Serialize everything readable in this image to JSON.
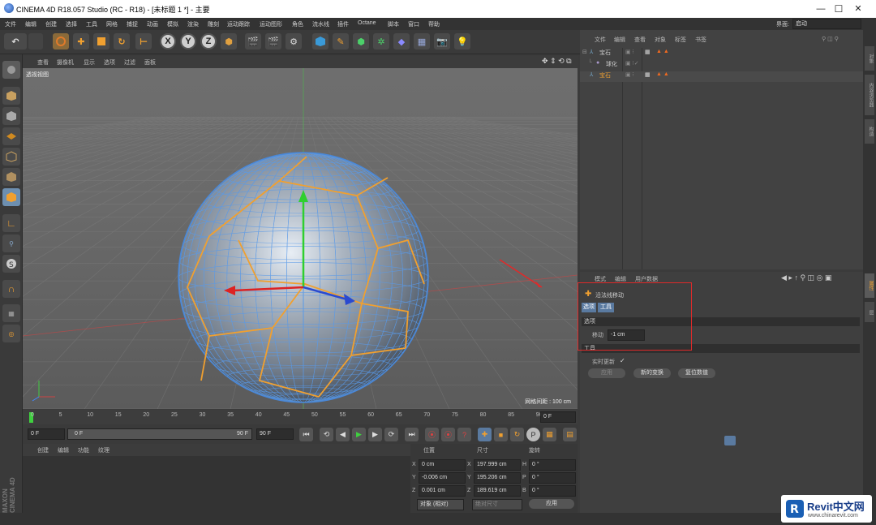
{
  "window": {
    "title": "CINEMA 4D R18.057 Studio (RC - R18) - [未标题 1 *] - 主要",
    "min": "—",
    "max": "☐",
    "close": "✕"
  },
  "menubar": {
    "items": [
      "文件",
      "编辑",
      "创建",
      "选择",
      "工具",
      "网格",
      "捕捉",
      "动画",
      "模拟",
      "渲染",
      "雕刻",
      "运动跟踪",
      "运动图形",
      "角色",
      "流水线",
      "插件",
      "Octane",
      "脚本",
      "窗口",
      "帮助"
    ],
    "layout_label": "界面:",
    "layout_value": "启动"
  },
  "toolbar": {
    "x": "X",
    "y": "Y",
    "z": "Z"
  },
  "viewport": {
    "menu": [
      "查看",
      "摄像机",
      "显示",
      "选项",
      "过滤",
      "面板"
    ],
    "label": "透视视图",
    "grid_spacing": "网格间距 : 100 cm"
  },
  "timeline": {
    "ticks": [
      "0",
      "5",
      "10",
      "15",
      "20",
      "25",
      "30",
      "35",
      "40",
      "45",
      "50",
      "55",
      "60",
      "65",
      "70",
      "75",
      "80",
      "85",
      "90"
    ],
    "end_field": "0 F"
  },
  "transport": {
    "current": "0 F",
    "start": "0 F",
    "end_a": "90 F",
    "end_b": "90 F"
  },
  "material": {
    "menu": [
      "创建",
      "编辑",
      "功能",
      "纹理"
    ]
  },
  "coords": {
    "headers": [
      "位置",
      "尺寸",
      "旋转"
    ],
    "rows": [
      {
        "axis": "X",
        "pos": "0 cm",
        "size": "197.999 cm",
        "rot_axis": "H",
        "rot": "0 °"
      },
      {
        "axis": "Y",
        "pos": "-0.006 cm",
        "size": "195.206 cm",
        "rot_axis": "P",
        "rot": "0 °"
      },
      {
        "axis": "Z",
        "pos": "0.001 cm",
        "size": "189.619 cm",
        "rot_axis": "B",
        "rot": "0 °"
      }
    ],
    "mode": "对象 (相对)",
    "size_mode": "绝对尺寸",
    "apply": "应用"
  },
  "objects": {
    "menu": [
      "文件",
      "编辑",
      "查看",
      "对象",
      "标签",
      "书签"
    ],
    "rows": [
      {
        "name": "宝石",
        "depth": 0,
        "selected": false
      },
      {
        "name": "球化",
        "depth": 1,
        "selected": false
      },
      {
        "name": "宝石",
        "depth": 0,
        "selected": true
      }
    ]
  },
  "attributes": {
    "menu": [
      "模式",
      "编辑",
      "用户数据"
    ],
    "tool_name": "沿法线移动",
    "tabs": [
      "选项",
      "工具"
    ],
    "section_options": "选项",
    "move_label": "移动",
    "move_value": "-1 cm",
    "section_tool": "工具",
    "realtime_label": "实时更新",
    "realtime_check": "✓",
    "btn_apply": "应用",
    "btn_new": "新的变换",
    "btn_reset": "复位数值"
  },
  "right_tabs": [
    "对象",
    "内容浏览器",
    "构造",
    "属性",
    "层"
  ],
  "branding": {
    "vertical": "MAXON CINEMA 4D",
    "watermark_main": "Revit中文网",
    "watermark_url": "www.chinarevit.com"
  },
  "colors": {
    "accent_orange": "#f0a030",
    "red_box": "#e02a2a",
    "sphere_wire": "#4a88d8"
  }
}
